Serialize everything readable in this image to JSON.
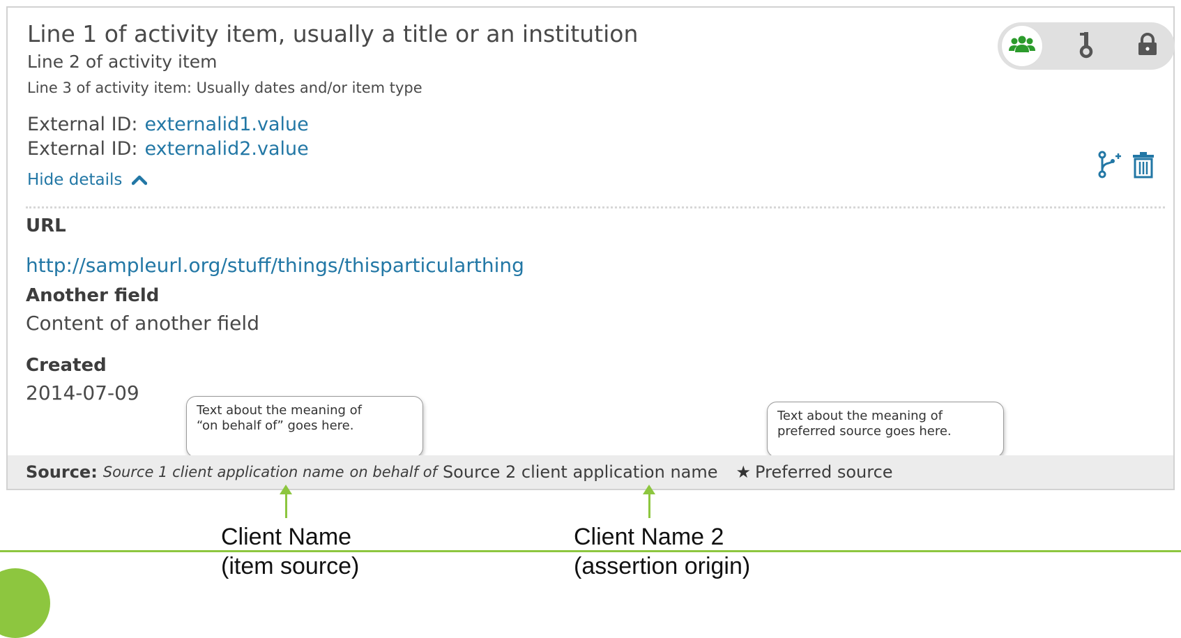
{
  "activity": {
    "line1": "Line 1 of activity item, usually a title  or an institution",
    "line2": "Line 2 of activity item",
    "line3": "Line 3 of activity item: Usually dates and/or item type",
    "external_ids": [
      {
        "label": "External ID:",
        "value": "externalid1.value"
      },
      {
        "label": "External ID:",
        "value": "externalid2.value"
      }
    ],
    "hide_details": "Hide details"
  },
  "fields": {
    "url": {
      "label": "URL",
      "value": "http://sampleurl.org/stuff/things/thisparticularthing"
    },
    "another": {
      "label": "Another field",
      "value": "Content of another field"
    },
    "created": {
      "label": "Created",
      "value": "2014-07-09"
    }
  },
  "tooltips": {
    "on_behalf": {
      "line1": "Text about the meaning of",
      "line2": "“on behalf of” goes here."
    },
    "preferred": {
      "line1": "Text about the meaning of",
      "line2": "preferred source goes here."
    }
  },
  "source": {
    "label": "Source:",
    "source1": "Source 1 client application name",
    "on_behalf_of": "on behalf of",
    "source2": "Source 2 client application name",
    "preferred": "Preferred source"
  },
  "annotations": {
    "client1": {
      "line1": "Client Name",
      "line2": "(item source)"
    },
    "client2": {
      "line1": "Client Name 2",
      "line2": "(assertion origin)"
    }
  },
  "privacy": {
    "options": [
      {
        "icon": "everyone-icon",
        "active": true
      },
      {
        "icon": "key-icon",
        "active": false
      },
      {
        "icon": "lock-icon",
        "active": false
      }
    ]
  },
  "colors": {
    "link": "#2277a5",
    "privacy_green": "#2c9b2c",
    "annotation_green": "#8dc63f",
    "source_bar": "#ececec"
  }
}
